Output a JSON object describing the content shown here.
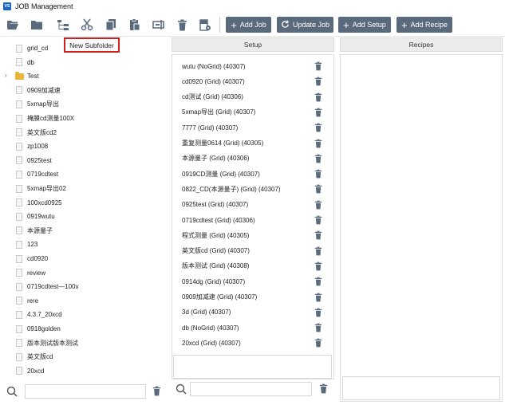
{
  "window": {
    "title": "JOB Management",
    "logo_text": "VS"
  },
  "toolbar": {
    "icons": [
      "open-folder-icon",
      "folder-icon",
      "tree-structure-icon",
      "cut-icon",
      "copy-icon",
      "paste-icon",
      "rename-icon",
      "delete-icon",
      "settings-document-icon"
    ],
    "buttons": {
      "add_job": "Add Job",
      "update_job": "Update Job",
      "add_setup": "Add Setup",
      "add_recipe": "Add Recipe"
    }
  },
  "context_button": {
    "label": "New Subfolder"
  },
  "tree": {
    "items": [
      {
        "label": "grid_cd",
        "type": "file"
      },
      {
        "label": "db",
        "type": "file"
      },
      {
        "label": "Test",
        "type": "folder"
      },
      {
        "label": "0909加减速",
        "type": "file"
      },
      {
        "label": "5xmap导出",
        "type": "file"
      },
      {
        "label": "掩膜cd测量100X",
        "type": "file"
      },
      {
        "label": "英文版cd2",
        "type": "file"
      },
      {
        "label": "zp1008",
        "type": "file"
      },
      {
        "label": "0925test",
        "type": "file"
      },
      {
        "label": "0719cdtest",
        "type": "file"
      },
      {
        "label": "5xmap导出02",
        "type": "file"
      },
      {
        "label": "100xcd0925",
        "type": "file"
      },
      {
        "label": "0919wutu",
        "type": "file"
      },
      {
        "label": "本源量子",
        "type": "file"
      },
      {
        "label": "123",
        "type": "file"
      },
      {
        "label": "cd0920",
        "type": "file"
      },
      {
        "label": "review",
        "type": "file"
      },
      {
        "label": "0719cdtest—100x",
        "type": "file"
      },
      {
        "label": "rere",
        "type": "file"
      },
      {
        "label": "4.3.7_20xcd",
        "type": "file"
      },
      {
        "label": "0918golden",
        "type": "file"
      },
      {
        "label": "版本测试版本测试",
        "type": "file"
      },
      {
        "label": "英文版cd",
        "type": "file"
      },
      {
        "label": "20xcd",
        "type": "file"
      }
    ]
  },
  "setup": {
    "header": "Setup",
    "items": [
      "wutu  (NoGrid) (40307)",
      "cd0920 (Grid) (40307)",
      "cd测试 (Grid) (40306)",
      "5xmap导出 (Grid) (40307)",
      "7777 (Grid) (40307)",
      "重复测量0614 (Grid) (40305)",
      "本源量子 (Grid) (40306)",
      "0919CD测量 (Grid) (40307)",
      "0822_CD(本源量子) (Grid) (40307)",
      "0925test (Grid) (40307)",
      "0719cdtest (Grid) (40306)",
      "程式测量 (Grid) (40305)",
      "英文版cd (Grid) (40307)",
      "版本测试 (Grid) (40308)",
      "0914dg (Grid) (40307)",
      "0909加减速 (Grid) (40307)",
      "3d (Grid) (40307)",
      "db (NoGrid) (40307)",
      "20xcd (Grid) (40307)"
    ]
  },
  "recipes": {
    "header": "Recipes"
  },
  "left_search": {
    "value": ""
  },
  "setup_search": {
    "value": ""
  },
  "colors": {
    "toolbar_button": "#5a6a7d",
    "highlight_border": "#d01f1f",
    "folder": "#e8b73a"
  }
}
